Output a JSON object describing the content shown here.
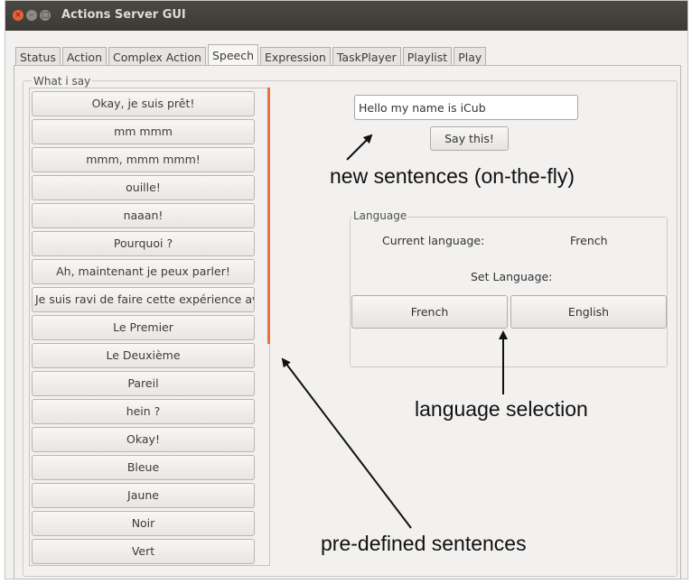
{
  "window": {
    "title": "Actions Server GUI",
    "close_glyph": "×",
    "min_glyph": "–",
    "max_glyph": "□"
  },
  "tabs": [
    "Status",
    "Action",
    "Complex Action",
    "Speech",
    "Expression",
    "TaskPlayer",
    "Playlist",
    "Play"
  ],
  "active_tab": "Speech",
  "group": {
    "label": "What i say"
  },
  "sentences": [
    "Okay, je suis prêt!",
    "mm mmm",
    "mmm, mmm mmm!",
    "ouille!",
    "naaan!",
    "Pourquoi ?",
    "Ah, maintenant je peux parler!",
    "Je suis ravi de faire cette expérience avec",
    "Le Premier",
    "Le Deuxième",
    "Pareil",
    "hein ?",
    "Okay!",
    "Bleue",
    "Jaune",
    "Noir",
    "Vert"
  ],
  "input": {
    "value": "Hello my name is iCub"
  },
  "say_button": "Say this!",
  "language": {
    "label": "Language",
    "current_label": "Current language:",
    "current_value": "French",
    "set_label": "Set Language:",
    "buttons": [
      "French",
      "English"
    ]
  },
  "annotations": {
    "new_sentences": "new sentences (on-the-fly)",
    "language_selection": "language selection",
    "predefined": "pre-defined sentences"
  },
  "colors": {
    "titlebar": "#3b3a36",
    "close_button": "#e9603a",
    "scroll_indicator": "#ec6d3f",
    "window_bg": "#f2f1f0"
  }
}
